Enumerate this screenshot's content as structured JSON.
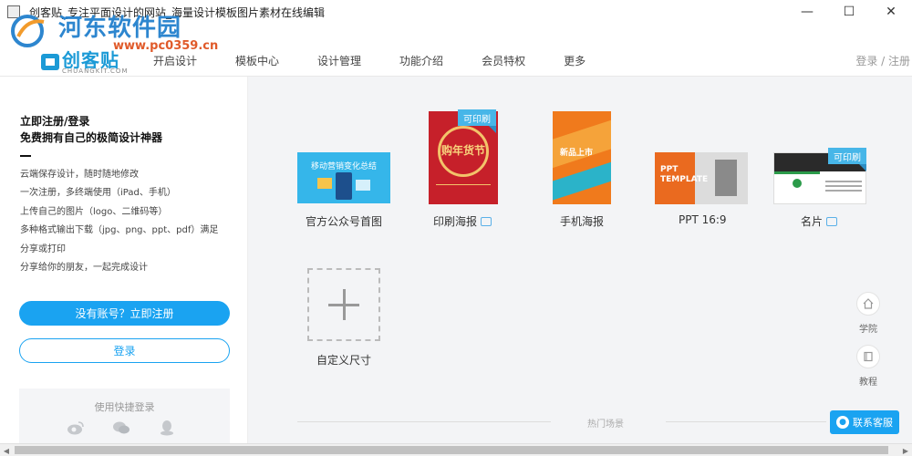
{
  "window": {
    "title": "创客贴_专注平面设计的网站_海量设计模板图片素材在线编辑",
    "controls": {
      "minimize": "—",
      "maximize": "☐",
      "close": "✕"
    }
  },
  "watermark": {
    "line1": "河东软件园",
    "line2": "www.pc0359.cn"
  },
  "brand": {
    "name": "创客贴",
    "sub": "CHUANGKIT.COM"
  },
  "nav": {
    "items": [
      {
        "label": "开启设计"
      },
      {
        "label": "模板中心"
      },
      {
        "label": "设计管理"
      },
      {
        "label": "功能介绍"
      },
      {
        "label": "会员特权"
      },
      {
        "label": "更多"
      }
    ],
    "login": "登录 / 注册"
  },
  "left_panel": {
    "heading1": "立即注册/登录",
    "heading2": "免费拥有自己的极简设计神器",
    "features": [
      "云端保存设计，随时随地修改",
      "一次注册，多终端使用（iPad、手机）",
      "上传自己的图片（logo、二维码等）",
      "多种格式输出下载（jpg、png、ppt、pdf）满足",
      "分享或打印",
      "分享给你的朋友，一起完成设计"
    ],
    "register_button": "没有账号？立即注册",
    "login_button": "登录",
    "quick_login_label": "使用快捷登录",
    "quick_login_icons": [
      "weibo-icon",
      "wechat-icon",
      "qq-icon"
    ]
  },
  "templates": [
    {
      "label": "官方公众号首图",
      "thumb_text": "移动营销变化总结",
      "printable": false
    },
    {
      "label": "印刷海报",
      "thumb_text": "购年货节",
      "printable": true,
      "badge": "可印刷"
    },
    {
      "label": "手机海报",
      "thumb_text": "新品上市",
      "printable": false
    },
    {
      "label": "PPT 16:9",
      "thumb_text": "PPT TEMPLATE",
      "printable": false
    },
    {
      "label": "名片",
      "printable": true,
      "badge": "可印刷"
    }
  ],
  "custom_size": {
    "label": "自定义尺寸"
  },
  "hot_scene": {
    "label": "热门场景"
  },
  "side_tools": [
    {
      "label": "学院",
      "icon": "home-icon"
    },
    {
      "label": "教程",
      "icon": "book-icon"
    }
  ],
  "contact": {
    "label": "联系客服"
  },
  "colors": {
    "accent": "#1aa3f1",
    "badge": "#47b6e8",
    "main_bg": "#f3f4f6"
  }
}
